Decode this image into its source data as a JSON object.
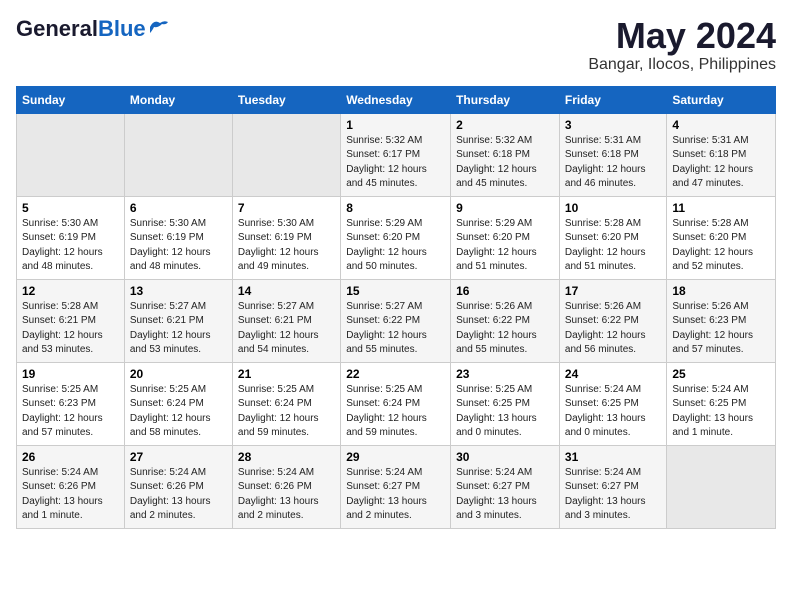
{
  "logo": {
    "general": "General",
    "blue": "Blue"
  },
  "title": "May 2024",
  "location": "Bangar, Ilocos, Philippines",
  "days_of_week": [
    "Sunday",
    "Monday",
    "Tuesday",
    "Wednesday",
    "Thursday",
    "Friday",
    "Saturday"
  ],
  "weeks": [
    [
      {
        "day": "",
        "info": ""
      },
      {
        "day": "",
        "info": ""
      },
      {
        "day": "",
        "info": ""
      },
      {
        "day": "1",
        "info": "Sunrise: 5:32 AM\nSunset: 6:17 PM\nDaylight: 12 hours\nand 45 minutes."
      },
      {
        "day": "2",
        "info": "Sunrise: 5:32 AM\nSunset: 6:18 PM\nDaylight: 12 hours\nand 45 minutes."
      },
      {
        "day": "3",
        "info": "Sunrise: 5:31 AM\nSunset: 6:18 PM\nDaylight: 12 hours\nand 46 minutes."
      },
      {
        "day": "4",
        "info": "Sunrise: 5:31 AM\nSunset: 6:18 PM\nDaylight: 12 hours\nand 47 minutes."
      }
    ],
    [
      {
        "day": "5",
        "info": "Sunrise: 5:30 AM\nSunset: 6:19 PM\nDaylight: 12 hours\nand 48 minutes."
      },
      {
        "day": "6",
        "info": "Sunrise: 5:30 AM\nSunset: 6:19 PM\nDaylight: 12 hours\nand 48 minutes."
      },
      {
        "day": "7",
        "info": "Sunrise: 5:30 AM\nSunset: 6:19 PM\nDaylight: 12 hours\nand 49 minutes."
      },
      {
        "day": "8",
        "info": "Sunrise: 5:29 AM\nSunset: 6:20 PM\nDaylight: 12 hours\nand 50 minutes."
      },
      {
        "day": "9",
        "info": "Sunrise: 5:29 AM\nSunset: 6:20 PM\nDaylight: 12 hours\nand 51 minutes."
      },
      {
        "day": "10",
        "info": "Sunrise: 5:28 AM\nSunset: 6:20 PM\nDaylight: 12 hours\nand 51 minutes."
      },
      {
        "day": "11",
        "info": "Sunrise: 5:28 AM\nSunset: 6:20 PM\nDaylight: 12 hours\nand 52 minutes."
      }
    ],
    [
      {
        "day": "12",
        "info": "Sunrise: 5:28 AM\nSunset: 6:21 PM\nDaylight: 12 hours\nand 53 minutes."
      },
      {
        "day": "13",
        "info": "Sunrise: 5:27 AM\nSunset: 6:21 PM\nDaylight: 12 hours\nand 53 minutes."
      },
      {
        "day": "14",
        "info": "Sunrise: 5:27 AM\nSunset: 6:21 PM\nDaylight: 12 hours\nand 54 minutes."
      },
      {
        "day": "15",
        "info": "Sunrise: 5:27 AM\nSunset: 6:22 PM\nDaylight: 12 hours\nand 55 minutes."
      },
      {
        "day": "16",
        "info": "Sunrise: 5:26 AM\nSunset: 6:22 PM\nDaylight: 12 hours\nand 55 minutes."
      },
      {
        "day": "17",
        "info": "Sunrise: 5:26 AM\nSunset: 6:22 PM\nDaylight: 12 hours\nand 56 minutes."
      },
      {
        "day": "18",
        "info": "Sunrise: 5:26 AM\nSunset: 6:23 PM\nDaylight: 12 hours\nand 57 minutes."
      }
    ],
    [
      {
        "day": "19",
        "info": "Sunrise: 5:25 AM\nSunset: 6:23 PM\nDaylight: 12 hours\nand 57 minutes."
      },
      {
        "day": "20",
        "info": "Sunrise: 5:25 AM\nSunset: 6:24 PM\nDaylight: 12 hours\nand 58 minutes."
      },
      {
        "day": "21",
        "info": "Sunrise: 5:25 AM\nSunset: 6:24 PM\nDaylight: 12 hours\nand 59 minutes."
      },
      {
        "day": "22",
        "info": "Sunrise: 5:25 AM\nSunset: 6:24 PM\nDaylight: 12 hours\nand 59 minutes."
      },
      {
        "day": "23",
        "info": "Sunrise: 5:25 AM\nSunset: 6:25 PM\nDaylight: 13 hours\nand 0 minutes."
      },
      {
        "day": "24",
        "info": "Sunrise: 5:24 AM\nSunset: 6:25 PM\nDaylight: 13 hours\nand 0 minutes."
      },
      {
        "day": "25",
        "info": "Sunrise: 5:24 AM\nSunset: 6:25 PM\nDaylight: 13 hours\nand 1 minute."
      }
    ],
    [
      {
        "day": "26",
        "info": "Sunrise: 5:24 AM\nSunset: 6:26 PM\nDaylight: 13 hours\nand 1 minute."
      },
      {
        "day": "27",
        "info": "Sunrise: 5:24 AM\nSunset: 6:26 PM\nDaylight: 13 hours\nand 2 minutes."
      },
      {
        "day": "28",
        "info": "Sunrise: 5:24 AM\nSunset: 6:26 PM\nDaylight: 13 hours\nand 2 minutes."
      },
      {
        "day": "29",
        "info": "Sunrise: 5:24 AM\nSunset: 6:27 PM\nDaylight: 13 hours\nand 2 minutes."
      },
      {
        "day": "30",
        "info": "Sunrise: 5:24 AM\nSunset: 6:27 PM\nDaylight: 13 hours\nand 3 minutes."
      },
      {
        "day": "31",
        "info": "Sunrise: 5:24 AM\nSunset: 6:27 PM\nDaylight: 13 hours\nand 3 minutes."
      },
      {
        "day": "",
        "info": ""
      }
    ]
  ]
}
